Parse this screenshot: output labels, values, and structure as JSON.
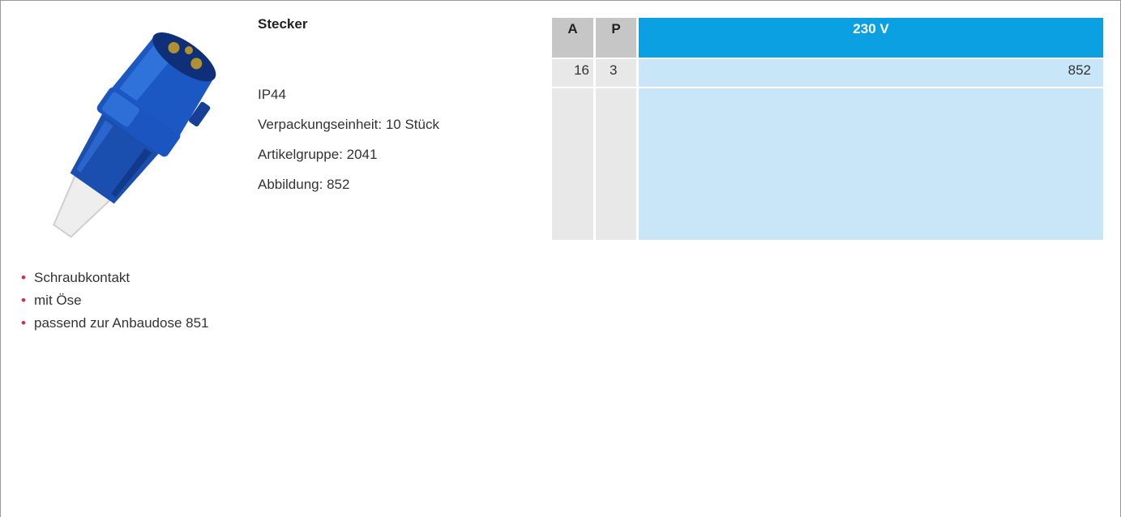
{
  "product": {
    "title": "Stecker",
    "image_icon": "cee-plug-blue-icon",
    "specs": [
      "IP44",
      "Verpackungseinheit: 10 Stück",
      "Artikelgruppe: 2041",
      "Abbildung: 852"
    ]
  },
  "table": {
    "headers": [
      "A",
      "P",
      "230 V"
    ],
    "rows": [
      {
        "a": "16",
        "p": "3",
        "value": "852"
      }
    ]
  },
  "features": [
    "Schraubkontakt",
    "mit Öse",
    "passend zur Anbaudose 851"
  ],
  "colors": {
    "header_blue": "#0aa0e1",
    "cell_blue": "#c8e6f8",
    "bullet_red": "#e3224d"
  }
}
